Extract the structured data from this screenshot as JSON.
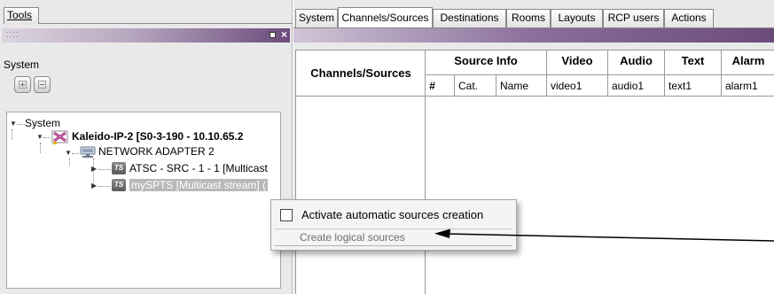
{
  "left_panel": {
    "menu_tab": "Tools",
    "grip": "⁚⁚⁚⁚",
    "section_label": "System",
    "tree": {
      "root": "System",
      "device": "Kaleido-IP-2 [S0-3-190 - 10.10.65.2",
      "adapter": "NETWORK ADAPTER 2",
      "stream_1": "ATSC - SRC - 1 - 1  [Multicast",
      "stream_2": "mySPTS [Multicast stream] (",
      "ts_badge": "TS"
    }
  },
  "tabs": [
    {
      "label": "System"
    },
    {
      "label": "Channels/Sources"
    },
    {
      "label": "Destinations"
    },
    {
      "label": "Rooms"
    },
    {
      "label": "Layouts"
    },
    {
      "label": "RCP users"
    },
    {
      "label": "Actions"
    }
  ],
  "grid": {
    "row_header": "Channels/Sources",
    "groups": [
      "Source Info",
      "Video",
      "Audio",
      "Text",
      "Alarm"
    ],
    "subheaders": [
      "#",
      "Cat.",
      "Name",
      "video1",
      "audio1",
      "text1",
      "alarm1"
    ]
  },
  "context_menu": {
    "activate_label": "Activate automatic sources creation",
    "activate_checked": false,
    "create_label": "Create logical sources"
  },
  "colors": {
    "titlebar_dark": "#6b4b7c",
    "selection": "#b9b9b9"
  }
}
